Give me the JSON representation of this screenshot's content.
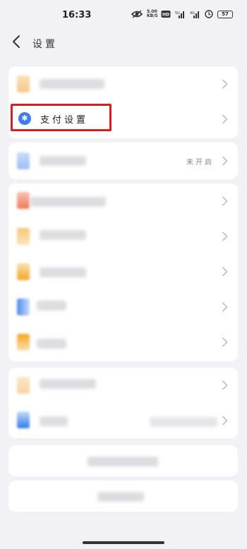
{
  "status": {
    "time": "16:33",
    "speed": "5.00 KB/S",
    "battery": "57"
  },
  "header": {
    "title": "设置"
  },
  "settings": {
    "pay_label": "支付设置",
    "not_enabled": "未开启"
  },
  "colors": {
    "highlight": "#d32020",
    "pay_icon": "#3d7bf0",
    "orange": "#f5a623",
    "blue": "#4a8cf0",
    "red": "#f07a5a"
  }
}
